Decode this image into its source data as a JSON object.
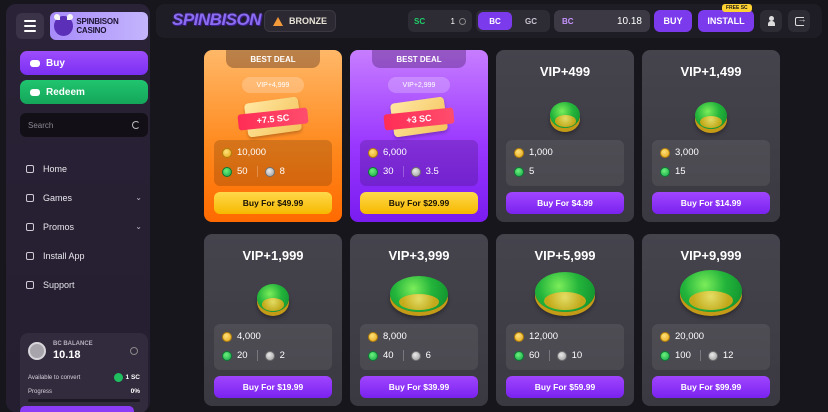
{
  "sidebar": {
    "logo_text": "SPINBISON CASINO",
    "buy_label": "Buy",
    "redeem_label": "Redeem",
    "search_placeholder": "Search",
    "nav": [
      {
        "label": "Home",
        "icon": "home-icon"
      },
      {
        "label": "Games",
        "icon": "gamepad-icon"
      },
      {
        "label": "Promos",
        "icon": "rocket-icon"
      },
      {
        "label": "Install App",
        "icon": "box-icon"
      },
      {
        "label": "Support",
        "icon": "headset-icon"
      }
    ],
    "balance": {
      "label": "BC BALANCE",
      "value": "10.18",
      "available_label": "Available to convert",
      "available_value": "1 SC",
      "progress_label": "Progress",
      "progress_value": "0%",
      "progress_fraction": 0
    }
  },
  "topbar": {
    "brand": "SPINBISON",
    "rank": "BRONZE",
    "sc_label": "SC",
    "sc_value": "1",
    "toggle_on": "BC",
    "toggle_off": "GC",
    "bc_label": "BC",
    "bc_value": "10.18",
    "buy_label": "BUY",
    "install_label": "INSTALL",
    "free_badge": "FREE SC",
    "accent": "#7c3aed"
  },
  "cards": [
    {
      "badge": "BEST DEAL",
      "title": "VIP+4,999",
      "ribbon": "+7.5 SC",
      "gold": "10,000",
      "green": "50",
      "silver": "8",
      "button": "Buy For $49.99"
    },
    {
      "badge": "BEST DEAL",
      "title": "VIP+2,999",
      "ribbon": "+3 SC",
      "gold": "6,000",
      "green": "30",
      "silver": "3.5",
      "button": "Buy For $29.99"
    },
    {
      "title": "VIP+499",
      "gold": "1,000",
      "green": "5",
      "button": "Buy For $4.99"
    },
    {
      "title": "VIP+1,499",
      "gold": "3,000",
      "green": "15",
      "button": "Buy For $14.99"
    },
    {
      "title": "VIP+1,999",
      "gold": "4,000",
      "green": "20",
      "silver": "2",
      "button": "Buy For $19.99"
    },
    {
      "title": "VIP+3,999",
      "gold": "8,000",
      "green": "40",
      "silver": "6",
      "button": "Buy For $39.99"
    },
    {
      "title": "VIP+5,999",
      "gold": "12,000",
      "green": "60",
      "silver": "10",
      "button": "Buy For $59.99"
    },
    {
      "title": "VIP+9,999",
      "gold": "20,000",
      "green": "100",
      "silver": "12",
      "button": "Buy For $99.99"
    }
  ]
}
